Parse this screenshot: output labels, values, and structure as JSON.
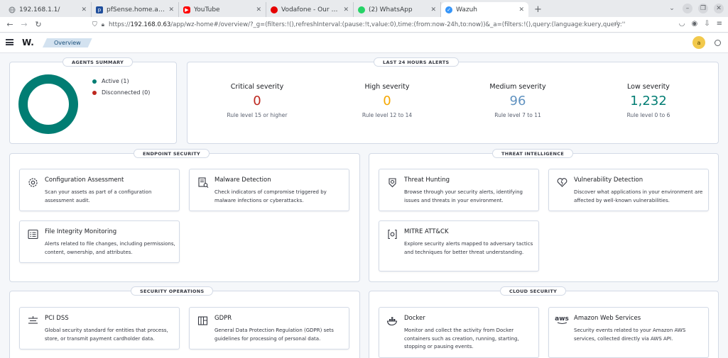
{
  "browser": {
    "tabs": [
      {
        "title": "192.168.1.1/",
        "favicon": "globe-icon",
        "color": "#80868b"
      },
      {
        "title": "pfSense.home.arpa - Stat",
        "favicon": "pfsense-icon",
        "color": "#1f4e9c"
      },
      {
        "title": "YouTube",
        "favicon": "youtube-icon",
        "color": "#ff0000"
      },
      {
        "title": "Vodafone - Our Best Ever",
        "favicon": "vodafone-icon",
        "color": "#e60000"
      },
      {
        "title": "(2) WhatsApp",
        "favicon": "whatsapp-icon",
        "color": "#25d366"
      },
      {
        "title": "Wazuh",
        "favicon": "wazuh-icon",
        "color": "#3595f9"
      }
    ],
    "new_tab": "+",
    "url_host": "192.168.0.63",
    "url_prefix": "https://",
    "url_path": "/app/wz-home#/overview/?_g=(filters:!(),refreshInterval:(pause:!t,value:0),time:(from:now-24h,to:now))&_a=(filters:!(),query:(language:kuery,query:''))"
  },
  "app": {
    "logo": "W.",
    "breadcrumb": "Overview",
    "avatar_letter": "a"
  },
  "agents_summary": {
    "title": "AGENTS SUMMARY",
    "active_label": "Active (1)",
    "disconnected_label": "Disconnected (0)",
    "active_count": 1,
    "disconnected_count": 0,
    "active_color": "#017d73",
    "disconnected_color": "#bd271e"
  },
  "alerts": {
    "title": "LAST 24 HOURS ALERTS",
    "items": [
      {
        "label": "Critical severity",
        "value": "0",
        "sub": "Rule level 15 or higher",
        "color": "#bd271e"
      },
      {
        "label": "High severity",
        "value": "0",
        "sub": "Rule level 12 to 14",
        "color": "#f5a700"
      },
      {
        "label": "Medium severity",
        "value": "96",
        "sub": "Rule level 7 to 11",
        "color": "#6092c0"
      },
      {
        "label": "Low severity",
        "value": "1,232",
        "sub": "Rule level 0 to 6",
        "color": "#017d73"
      }
    ]
  },
  "sections": {
    "endpoint": {
      "title": "ENDPOINT SECURITY",
      "cards": [
        {
          "title": "Configuration Assessment",
          "desc": "Scan your assets as part of a configuration assessment audit.",
          "icon": "gear-icon"
        },
        {
          "title": "Malware Detection",
          "desc": "Check indicators of compromise triggered by malware infections or cyberattacks.",
          "icon": "document-search-icon"
        },
        {
          "title": "File Integrity Monitoring",
          "desc": "Alerts related to file changes, including permissions, content, ownership, and attributes.",
          "icon": "list-icon"
        }
      ]
    },
    "threat": {
      "title": "THREAT INTELLIGENCE",
      "cards": [
        {
          "title": "Threat Hunting",
          "desc": "Browse through your security alerts, identifying issues and threats in your environment.",
          "icon": "security-app-icon"
        },
        {
          "title": "Vulnerability Detection",
          "desc": "Discover what applications in your environment are affected by well-known vulnerabilities.",
          "icon": "heart-icon"
        },
        {
          "title": "MITRE ATT&CK",
          "desc": "Explore security alerts mapped to adversary tactics and techniques for better threat understanding.",
          "icon": "mitre-icon"
        }
      ]
    },
    "secops": {
      "title": "SECURITY OPERATIONS",
      "cards": [
        {
          "title": "PCI DSS",
          "desc": "Global security standard for entities that process, store, or transmit payment cardholder data.",
          "icon": "pci-icon"
        },
        {
          "title": "GDPR",
          "desc": "General Data Protection Regulation (GDPR) sets guidelines for processing of personal data.",
          "icon": "gdpr-icon"
        }
      ]
    },
    "cloud": {
      "title": "CLOUD SECURITY",
      "cards": [
        {
          "title": "Docker",
          "desc": "Monitor and collect the activity from Docker containers such as creation, running, starting, stopping or pausing events.",
          "icon": "docker-icon"
        },
        {
          "title": "Amazon Web Services",
          "desc": "Security events related to your Amazon AWS services, collected directly via AWS API.",
          "icon": "aws-icon",
          "icon_text": "aws"
        }
      ]
    }
  }
}
